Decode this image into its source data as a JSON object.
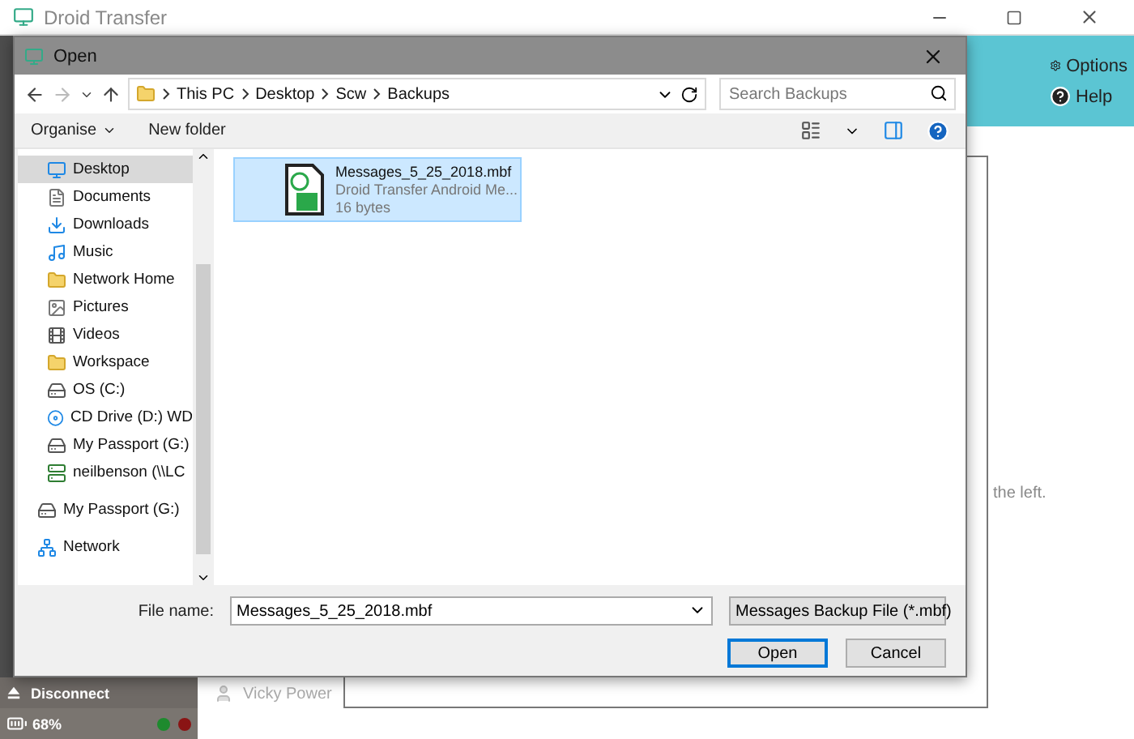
{
  "app": {
    "title": "Droid Transfer",
    "header_buttons": [
      {
        "kind": "options",
        "label": "Options"
      },
      {
        "kind": "help",
        "label": "Help"
      }
    ],
    "contacts": [
      {
        "name": "Vicky Power"
      }
    ],
    "hint_text": "the left.",
    "disconnect_label": "Disconnect",
    "battery": "68%",
    "status_dots": [
      {
        "color": "#1e8a2e"
      },
      {
        "color": "#8a1414"
      }
    ]
  },
  "dialog": {
    "title": "Open",
    "breadcrumb": [
      "This PC",
      "Desktop",
      "Scw",
      "Backups"
    ],
    "search_placeholder": "Search Backups",
    "organise": "Organise",
    "new_folder": "New folder",
    "nav_pane": {
      "nested_items": [
        {
          "label": "Desktop",
          "kind": "desktop",
          "selected": true
        },
        {
          "label": "Documents",
          "kind": "documents",
          "selected": false
        },
        {
          "label": "Downloads",
          "kind": "downloads",
          "selected": false
        },
        {
          "label": "Music",
          "kind": "music",
          "selected": false
        },
        {
          "label": "Network Home",
          "kind": "folder",
          "selected": false
        },
        {
          "label": "Pictures",
          "kind": "pictures",
          "selected": false
        },
        {
          "label": "Videos",
          "kind": "videos",
          "selected": false
        },
        {
          "label": "Workspace",
          "kind": "folder",
          "selected": false
        },
        {
          "label": "OS (C:)",
          "kind": "drive",
          "selected": false
        },
        {
          "label": "CD Drive (D:) WD",
          "kind": "cd",
          "selected": false
        },
        {
          "label": "My Passport (G:)",
          "kind": "drive",
          "selected": false
        },
        {
          "label": "neilbenson (\\\\LC",
          "kind": "network-drive",
          "selected": false
        }
      ],
      "top_items": [
        {
          "label": "My Passport (G:)",
          "kind": "drive",
          "selected": false
        },
        {
          "label": "Network",
          "kind": "network",
          "selected": false
        }
      ]
    },
    "files": [
      {
        "name": "Messages_5_25_2018.mbf",
        "type": "Droid Transfer Android Me...",
        "size": "16 bytes",
        "selected": true
      }
    ],
    "file_name_label": "File name:",
    "file_name_value": "Messages_5_25_2018.mbf",
    "file_type": "Messages Backup File (*.mbf)",
    "buttons": [
      {
        "kind": "primary",
        "label": "Open"
      },
      {
        "kind": "secondary",
        "label": "Cancel"
      }
    ]
  }
}
